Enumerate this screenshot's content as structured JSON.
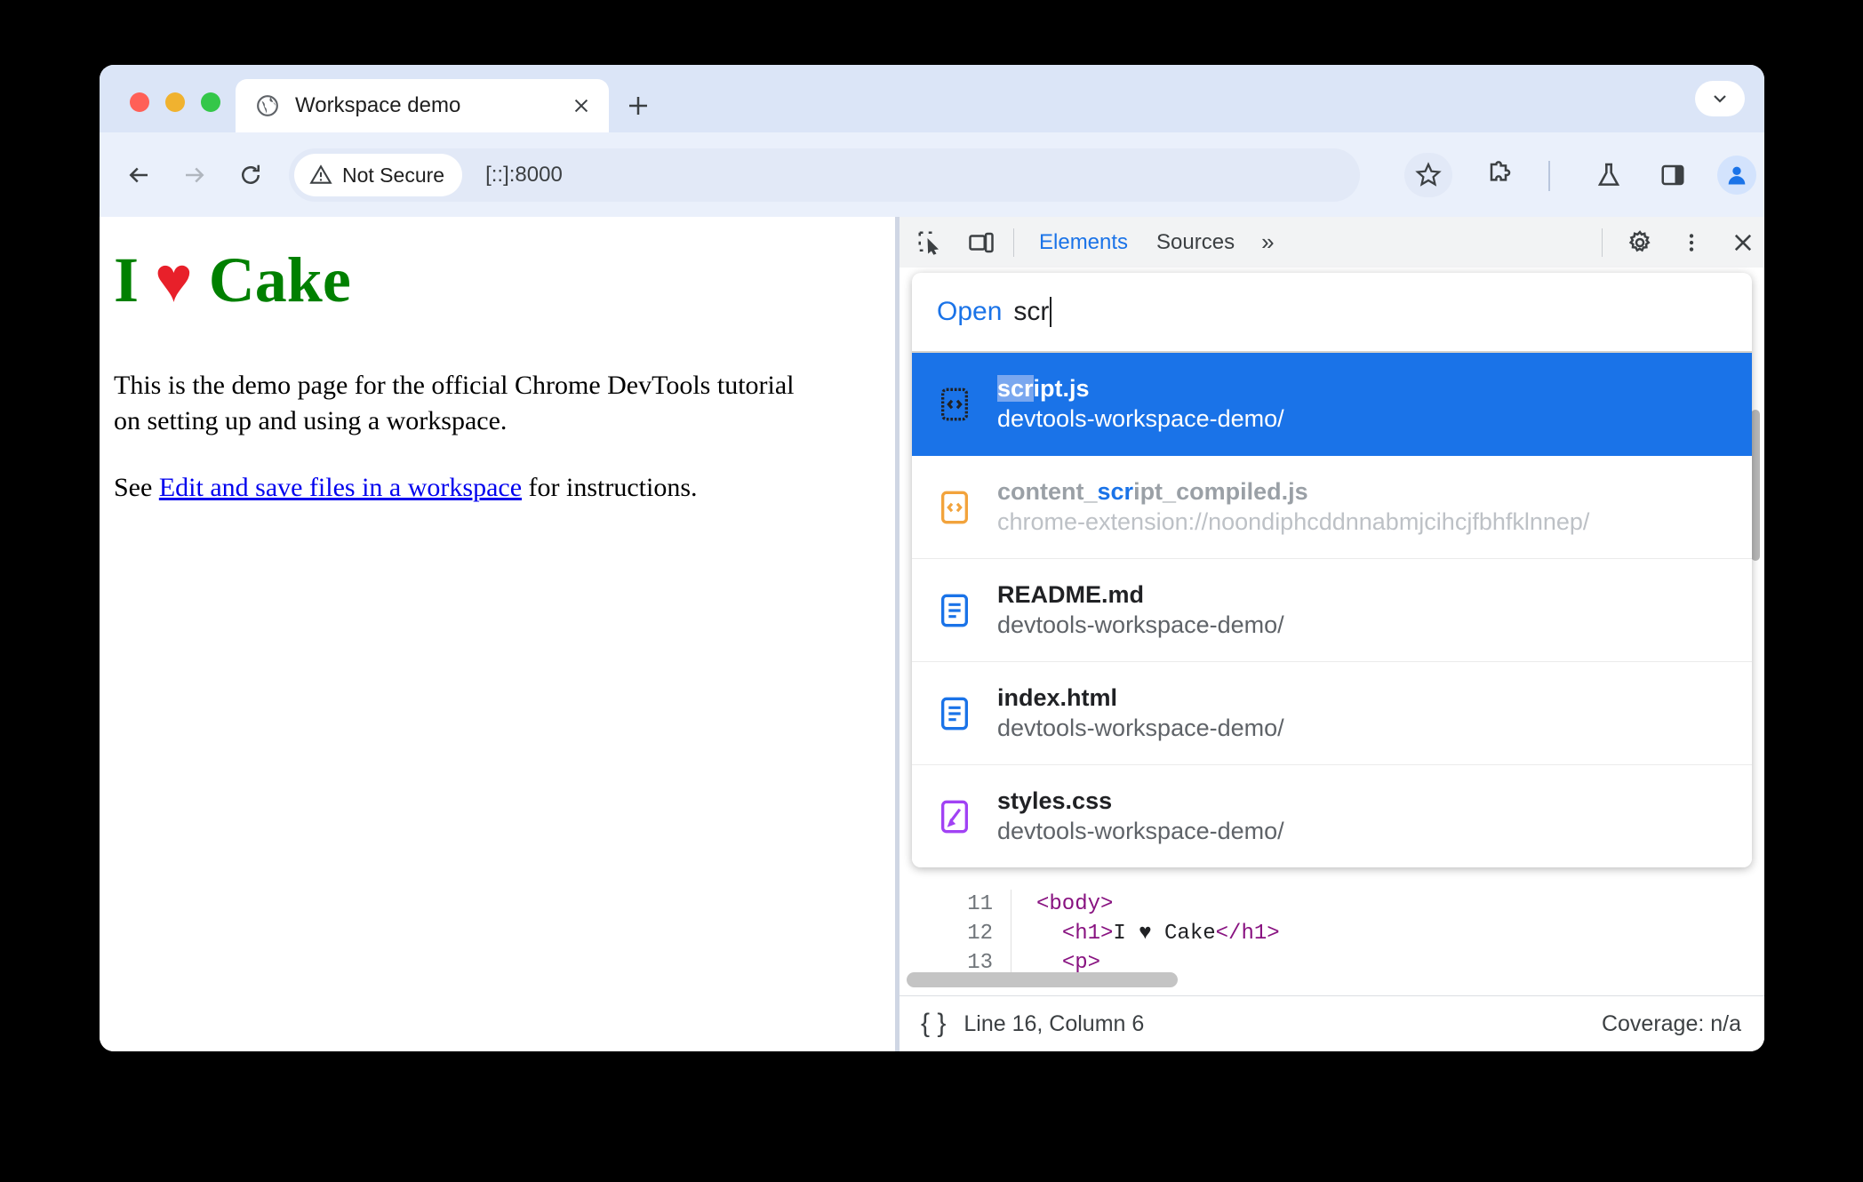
{
  "window": {
    "tab": {
      "favicon": "globe-icon",
      "title": "Workspace demo",
      "close_icon": "close-icon"
    },
    "new_tab_icon": "plus-icon",
    "tabstrip_expand_icon": "chevron-down-icon"
  },
  "toolbar": {
    "back_icon": "arrow-left-icon",
    "forward_icon": "arrow-right-icon",
    "reload_icon": "reload-icon",
    "security_chip": {
      "icon": "warning-triangle-icon",
      "label": "Not Secure"
    },
    "url": "[::]:8000",
    "bookmark_icon": "star-icon",
    "extensions_icon": "puzzle-piece-icon",
    "lab_icon": "flask-icon",
    "side_panel_icon": "side-panel-icon",
    "profile_icon": "avatar-icon",
    "menu_icon": "three-dot-menu-icon"
  },
  "page": {
    "heading_before": "I ",
    "heading_heart": "♥",
    "heading_after": " Cake",
    "paragraph1": "This is the demo page for the official Chrome DevTools tutorial on setting up and using a workspace.",
    "paragraph2_before": "See ",
    "link_text": "Edit and save files in a workspace",
    "paragraph2_after": " for instructions."
  },
  "devtools": {
    "inspect_icon": "inspect-cursor-icon",
    "device_icon": "device-toggle-icon",
    "tabs": [
      {
        "label": "Elements",
        "active": true
      },
      {
        "label": "Sources",
        "active": false
      }
    ],
    "overflow_label": "»",
    "settings_icon": "gear-icon",
    "more_icon": "three-dot-menu-icon",
    "close_icon": "close-icon",
    "editor": {
      "lines": [
        {
          "number": "11",
          "html": "<body>"
        },
        {
          "number": "12",
          "html": "  <h1>I ♥ Cake</h1>"
        },
        {
          "number": "13",
          "html": "  <p>"
        }
      ]
    },
    "status": {
      "braces_icon": "pretty-print-icon",
      "position": "Line 16, Column 6",
      "coverage": "Coverage: n/a"
    }
  },
  "palette": {
    "prefix": "Open",
    "query": "scr",
    "results": [
      {
        "icon": "js-file-icon",
        "title_pre": "",
        "title_match": "scr",
        "title_post": "ipt.js",
        "subtitle": "devtools-workspace-demo/",
        "selected": true,
        "dim": false
      },
      {
        "icon": "js-file-icon-orange",
        "title_pre": "content_",
        "title_match": "scr",
        "title_post": "ipt_compiled.js",
        "subtitle": "chrome-extension://noondiphcddnnabmjcihcjfbhfklnnep/",
        "selected": false,
        "dim": true
      },
      {
        "icon": "document-file-icon",
        "title_pre": "README.md",
        "title_match": "",
        "title_post": "",
        "subtitle": "devtools-workspace-demo/",
        "selected": false,
        "dim": false
      },
      {
        "icon": "document-file-icon",
        "title_pre": "index.html",
        "title_match": "",
        "title_post": "",
        "subtitle": "devtools-workspace-demo/",
        "selected": false,
        "dim": false
      },
      {
        "icon": "css-file-icon",
        "title_pre": "styles.css",
        "title_match": "",
        "title_post": "",
        "subtitle": "devtools-workspace-demo/",
        "selected": false,
        "dim": false
      }
    ]
  },
  "colors": {
    "accent": "#1a73e8",
    "selected_row": "#1a73e8",
    "heading_green": "#008000",
    "heart_red": "#e8202a",
    "link_blue": "#0000ee"
  }
}
